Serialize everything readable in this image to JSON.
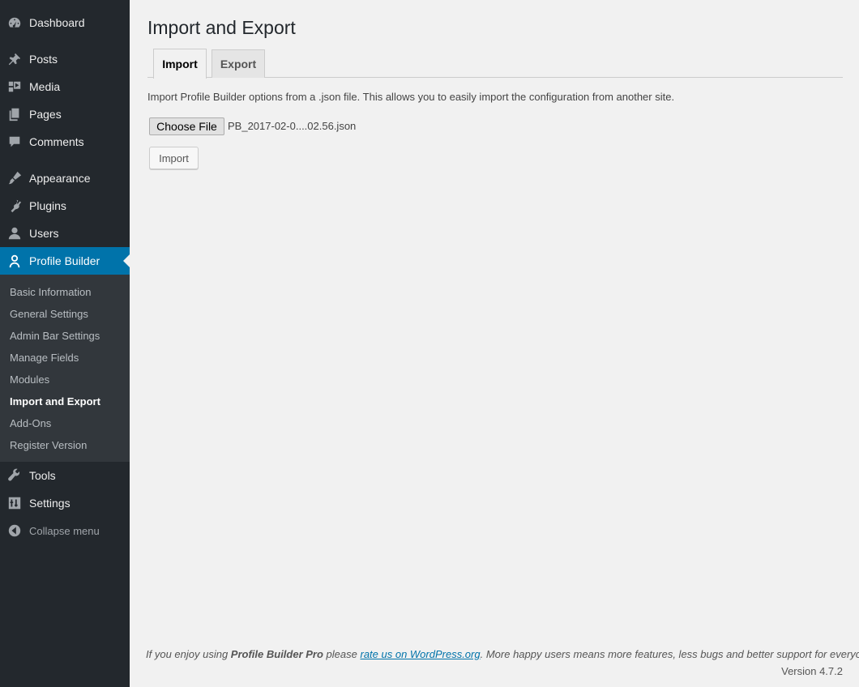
{
  "sidebar": {
    "items": [
      {
        "label": "Dashboard",
        "icon": "dashboard-icon"
      },
      {
        "label": "Posts",
        "icon": "pushpin-icon"
      },
      {
        "label": "Media",
        "icon": "media-icon"
      },
      {
        "label": "Pages",
        "icon": "pages-icon"
      },
      {
        "label": "Comments",
        "icon": "comment-icon"
      },
      {
        "label": "Appearance",
        "icon": "paintbrush-icon"
      },
      {
        "label": "Plugins",
        "icon": "plug-icon"
      },
      {
        "label": "Users",
        "icon": "user-icon"
      },
      {
        "label": "Profile Builder",
        "icon": "profile-icon"
      },
      {
        "label": "Tools",
        "icon": "wrench-icon"
      },
      {
        "label": "Settings",
        "icon": "sliders-icon"
      },
      {
        "label": "Collapse menu",
        "icon": "collapse-arrow-icon"
      }
    ],
    "submenu": [
      {
        "label": "Basic Information"
      },
      {
        "label": "General Settings"
      },
      {
        "label": "Admin Bar Settings"
      },
      {
        "label": "Manage Fields"
      },
      {
        "label": "Modules"
      },
      {
        "label": "Import and Export"
      },
      {
        "label": "Add-Ons"
      },
      {
        "label": "Register Version"
      }
    ]
  },
  "main": {
    "title": "Import and Export",
    "tabs": [
      {
        "label": "Import"
      },
      {
        "label": "Export"
      }
    ],
    "description": "Import Profile Builder options from a .json file. This allows you to easily import the configuration from another site.",
    "file_button": "Choose File",
    "file_name": "PB_2017-02-0....02.56.json",
    "import_button": "Import"
  },
  "footer": {
    "text_before": "If you enjoy using ",
    "product": "Profile Builder Pro",
    "text_mid": " please ",
    "link": "rate us on WordPress.org",
    "text_after": ". More happy users means more features, less bugs and better support for everyone.",
    "version": "Version 4.7.2"
  },
  "colors": {
    "sidebar_bg": "#23282d",
    "submenu_bg": "#32373c",
    "accent": "#0073aa",
    "page_bg": "#f1f1f1"
  }
}
